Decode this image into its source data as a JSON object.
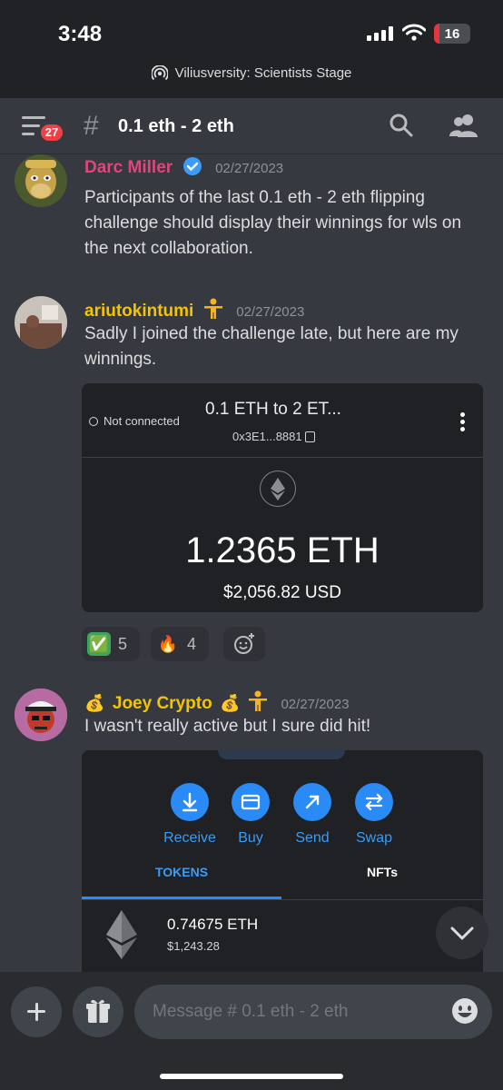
{
  "status": {
    "time": "3:48",
    "battery": "16"
  },
  "stage_banner": "Viliusversity: Scientists Stage",
  "header": {
    "unread_badge": "27",
    "channel_name": "0.1 eth - 2 eth"
  },
  "messages": [
    {
      "author": "Darc Miller",
      "timestamp": "02/27/2023",
      "text": "Participants of the last 0.1 eth - 2 eth flipping challenge should display their winnings for wls on the next collaboration.",
      "author_color": "#e0457b"
    },
    {
      "author": "ariutokintumi",
      "timestamp": "02/27/2023",
      "text": "Sadly I joined the challenge late, but here are my winnings.",
      "author_color": "#f5c400",
      "embed": {
        "connection_status": "Not connected",
        "account_name": "0.1 ETH to 2 ET...",
        "address": "0x3E1...8881",
        "balance": "1.2365 ETH",
        "balance_usd": "$2,056.82 USD"
      },
      "reactions": [
        {
          "emoji": "✅",
          "count": "5"
        },
        {
          "emoji": "🔥",
          "count": "4"
        }
      ]
    },
    {
      "author": "Joey Crypto",
      "timestamp": "02/27/2023",
      "text": "I wasn't really active but I sure did hit!",
      "author_color": "#f5c400",
      "embed": {
        "actions": [
          "Receive",
          "Buy",
          "Send",
          "Swap"
        ],
        "tabs": [
          "TOKENS",
          "NFTs"
        ],
        "token_amount": "0.74675 ETH",
        "token_usd": "$1,243.28"
      }
    }
  ],
  "composer": {
    "placeholder": "Message # 0.1 eth - 2 eth"
  },
  "colors": {
    "background": "#36393f",
    "accent_blue": "#2a8af6",
    "badge_red": "#ed4245"
  }
}
